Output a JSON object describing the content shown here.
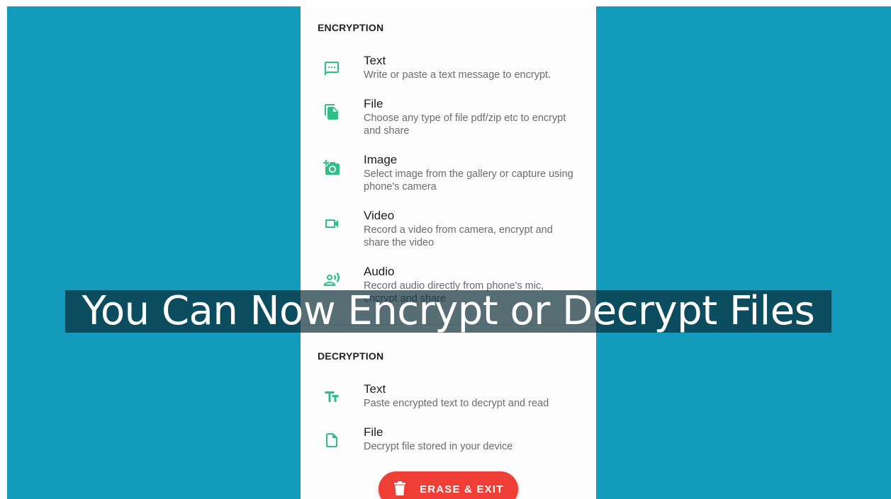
{
  "encryption": {
    "header": "ENCRYPTION",
    "items": [
      {
        "title": "Text",
        "description": "Write or paste a text message to encrypt.",
        "icon": "message-icon"
      },
      {
        "title": "File",
        "description": "Choose any type of file pdf/zip etc to encrypt and share",
        "icon": "files-icon"
      },
      {
        "title": "Image",
        "description": "Select image from the gallery or capture using phone's camera",
        "icon": "add-photo-icon"
      },
      {
        "title": "Video",
        "description": "Record a video from camera, encrypt and share the video",
        "icon": "videocam-icon"
      },
      {
        "title": "Audio",
        "description": "Record audio directly from phone's mic, encrypt and share",
        "icon": "record-voice-icon"
      }
    ]
  },
  "decryption": {
    "header": "DECRYPTION",
    "items": [
      {
        "title": "Text",
        "description": "Paste encrypted text to decrypt and read",
        "icon": "text-fields-icon"
      },
      {
        "title": "File",
        "description": "Decrypt file stored in your device",
        "icon": "file-icon"
      }
    ]
  },
  "erase_button": {
    "label": "ERASE & EXIT",
    "icon": "trash-icon"
  },
  "caption": "You Can Now Encrypt or Decrypt Files",
  "colors": {
    "background": "#139bbc",
    "accent": "#2fbf86",
    "danger": "#ef3e36"
  }
}
